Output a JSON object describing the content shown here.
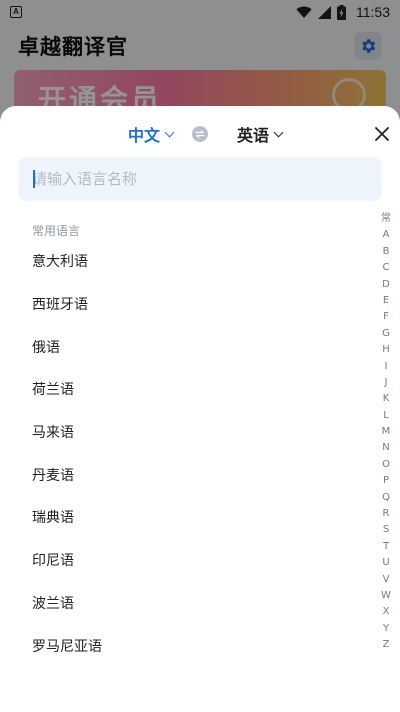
{
  "status_bar": {
    "notification_icon": "A",
    "time": "11:53",
    "icons": [
      "wifi-icon",
      "signal-icon",
      "battery-icon"
    ]
  },
  "app": {
    "title": "卓越翻译官",
    "banner_text": "开通会员"
  },
  "sheet": {
    "source_language": "中文",
    "target_language": "英语",
    "search_placeholder": "请输入语言名称",
    "section_label": "常用语言",
    "languages": [
      "意大利语",
      "西班牙语",
      "俄语",
      "荷兰语",
      "马来语",
      "丹麦语",
      "瑞典语",
      "印尼语",
      "波兰语",
      "罗马尼亚语"
    ],
    "index_letters": [
      "常",
      "A",
      "B",
      "C",
      "D",
      "E",
      "F",
      "G",
      "H",
      "I",
      "J",
      "K",
      "L",
      "M",
      "N",
      "O",
      "P",
      "Q",
      "R",
      "S",
      "T",
      "U",
      "V",
      "W",
      "X",
      "Y",
      "Z"
    ]
  },
  "colors": {
    "accent": "#1f6fd6",
    "search_bg": "#eef5fd",
    "overlay": "rgba(0,0,0,0.42)"
  }
}
